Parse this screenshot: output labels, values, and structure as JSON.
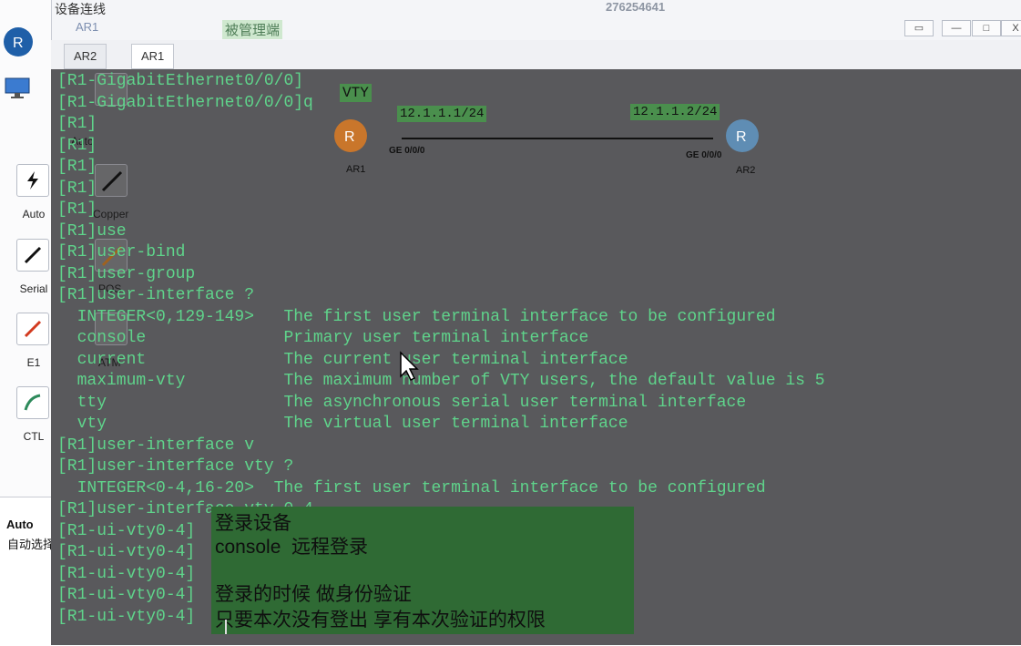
{
  "window": {
    "session_id": "276254641",
    "controls": [
      "▭",
      "—",
      "□",
      "X"
    ],
    "group_title": "设备连线"
  },
  "top_devices": {
    "tag_left": "AR1",
    "tag_right": "被管理端"
  },
  "tabs": [
    {
      "label": "AR2",
      "active": false
    },
    {
      "label": "AR1",
      "active": true
    }
  ],
  "sidebar": {
    "cables": [
      {
        "label": "Auto",
        "icon": "lightning-icon"
      },
      {
        "label": "Serial",
        "icon": "serial-cable-icon"
      },
      {
        "label": "E1",
        "icon": "e1-cable-icon"
      },
      {
        "label": "CTL",
        "icon": "ctl-cable-icon"
      }
    ],
    "ghost_cables": [
      {
        "label": "Auto"
      },
      {
        "label": "Copper"
      },
      {
        "label": "POS"
      },
      {
        "label": "ATM"
      }
    ],
    "description_title": "Auto",
    "description_text": "自动选择接口连接设备。"
  },
  "topology": {
    "tag": "VTY",
    "left_ip": "12.1.1.1/24",
    "right_ip": "12.1.1.2/24",
    "left_port": "GE 0/0/0",
    "right_port": "GE 0/0/0",
    "left_name": "AR1",
    "right_name": "AR2"
  },
  "terminal": {
    "lines": [
      "[R1-GigabitEthernet0/0/0]",
      "[R1-GigabitEthernet0/0/0]q",
      "[R1]",
      "[R1]",
      "[R1]",
      "[R1]",
      "[R1]",
      "[R1]use",
      "[R1]user-bind",
      "[R1]user-group",
      "[R1]user-interface ?",
      "  INTEGER<0,129-149>   The first user terminal interface to be configured",
      "  console              Primary user terminal interface",
      "  current              The current user terminal interface",
      "  maximum-vty          The maximum number of VTY users, the default value is 5",
      "  tty                  The asynchronous serial user terminal interface",
      "  vty                  The virtual user terminal interface",
      "[R1]user-interface v",
      "[R1]user-interface vty ?",
      "  INTEGER<0-4,16-20>  The first user terminal interface to be configured",
      "[R1]user-interface vty 0 4",
      "[R1-ui-vty0-4]",
      "[R1-ui-vty0-4]",
      "[R1-ui-vty0-4]",
      "[R1-ui-vty0-4]",
      "[R1-ui-vty0-4]"
    ]
  },
  "note": {
    "lines": [
      "登录设备",
      "console  远程登录",
      "",
      "登录的时候 做身份验证",
      "只要本次没有登出 享有本次验证的权限"
    ]
  },
  "colors": {
    "terminal_bg": "#59595c",
    "terminal_text": "#5fd48b",
    "note_bg": "#2f6a34"
  }
}
